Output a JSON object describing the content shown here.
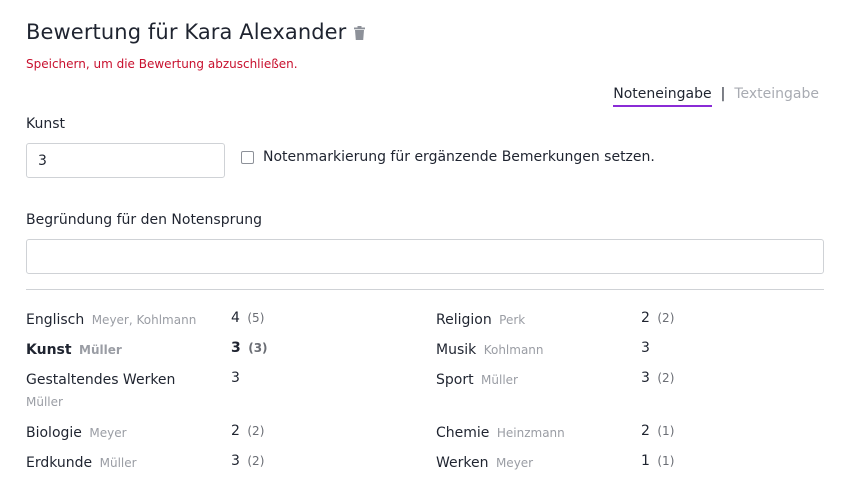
{
  "header": {
    "title": "Bewertung für Kara Alexander",
    "delete_icon": "trash-icon",
    "hint": "Speichern, um die Bewertung abzuschließen."
  },
  "mode_switch": {
    "active": "Noteneingabe",
    "separator": "|",
    "inactive": "Texteingabe",
    "accent_color": "#8a2bd6"
  },
  "form": {
    "subject_label": "Kunst",
    "grade_value": "3",
    "mark_checkbox_label": "Notenmarkierung für ergänzende Bemerkungen setzen.",
    "mark_checked": false,
    "reason_label": "Begründung für den Notensprung",
    "reason_value": ""
  },
  "grades": {
    "left": [
      {
        "subject": "Englisch",
        "teacher": "Meyer, Kohlmann",
        "grade": "4",
        "previous": "(5)",
        "current": false
      },
      {
        "subject": "Kunst",
        "teacher": "Müller",
        "grade": "3",
        "previous": "(3)",
        "current": true
      },
      {
        "subject": "Gestaltendes Werken",
        "teacher": "Müller",
        "grade": "3",
        "previous": "",
        "current": false
      },
      {
        "subject": "Biologie",
        "teacher": "Meyer",
        "grade": "2",
        "previous": "(2)",
        "current": false
      },
      {
        "subject": "Erdkunde",
        "teacher": "Müller",
        "grade": "3",
        "previous": "(2)",
        "current": false
      }
    ],
    "right": [
      {
        "subject": "Religion",
        "teacher": "Perk",
        "grade": "2",
        "previous": "(2)",
        "current": false
      },
      {
        "subject": "Musik",
        "teacher": "Kohlmann",
        "grade": "3",
        "previous": "",
        "current": false
      },
      {
        "subject": "Sport",
        "teacher": "Müller",
        "grade": "3",
        "previous": "(2)",
        "current": false
      },
      {
        "subject": "Chemie",
        "teacher": "Heinzmann",
        "grade": "2",
        "previous": "(1)",
        "current": false
      },
      {
        "subject": "Werken",
        "teacher": "Meyer",
        "grade": "1",
        "previous": "(1)",
        "current": false
      }
    ]
  },
  "colors": {
    "error_text": "#c8102e",
    "muted_text": "#9a9da4"
  }
}
